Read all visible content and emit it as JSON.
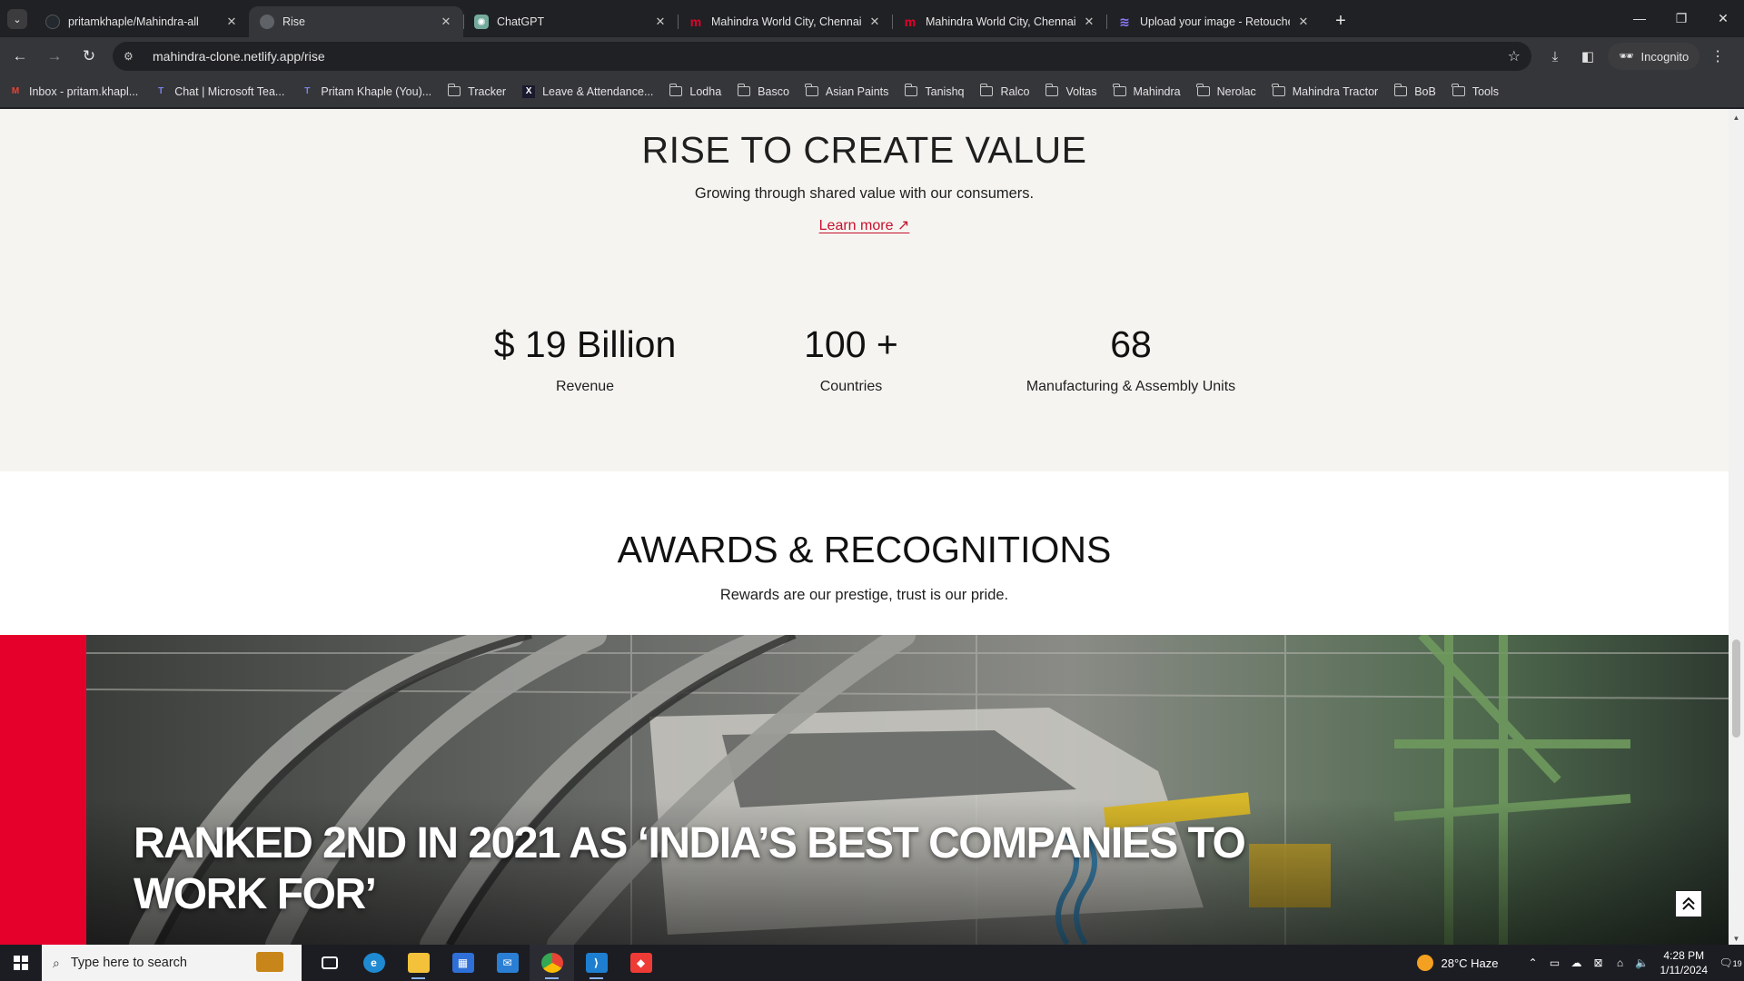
{
  "browser": {
    "tabs": [
      {
        "title": "pritamkhaple/Mahindra-all",
        "favicon": "github-icon",
        "active": false
      },
      {
        "title": "Rise",
        "favicon": "globe-icon",
        "active": true
      },
      {
        "title": "ChatGPT",
        "favicon": "chatgpt-icon",
        "active": false
      },
      {
        "title": "Mahindra World City, Chennai s",
        "favicon": "mahindra-icon",
        "active": false
      },
      {
        "title": "Mahindra World City, Chennai s",
        "favicon": "mahindra-icon",
        "active": false
      },
      {
        "title": "Upload your image - Retoucher",
        "favicon": "retoucher-icon",
        "active": false
      }
    ],
    "url": "mahindra-clone.netlify.app/rise",
    "incognito_label": "Incognito",
    "bookmarks": [
      {
        "label": "Inbox - pritam.khapl...",
        "icon": "gmail-icon"
      },
      {
        "label": "Chat | Microsoft Tea...",
        "icon": "teams-icon"
      },
      {
        "label": "Pritam Khaple (You)...",
        "icon": "teams-icon"
      },
      {
        "label": "Tracker",
        "icon": "folder-icon"
      },
      {
        "label": "Leave & Attendance...",
        "icon": "x-icon"
      },
      {
        "label": "Lodha",
        "icon": "folder-icon"
      },
      {
        "label": "Basco",
        "icon": "folder-icon"
      },
      {
        "label": "Asian Paints",
        "icon": "folder-icon"
      },
      {
        "label": "Tanishq",
        "icon": "folder-icon"
      },
      {
        "label": "Ralco",
        "icon": "folder-icon"
      },
      {
        "label": "Voltas",
        "icon": "folder-icon"
      },
      {
        "label": "Mahindra",
        "icon": "folder-icon"
      },
      {
        "label": "Nerolac",
        "icon": "folder-icon"
      },
      {
        "label": "Mahindra Tractor",
        "icon": "folder-icon"
      },
      {
        "label": "BoB",
        "icon": "folder-icon"
      },
      {
        "label": "Tools",
        "icon": "folder-icon"
      }
    ]
  },
  "page": {
    "value": {
      "title": "RISE TO CREATE VALUE",
      "subtitle": "Growing through shared value with our consumers.",
      "learn_more": "Learn more ↗",
      "stats": [
        {
          "number": "$ 19 Billion",
          "label": "Revenue"
        },
        {
          "number": "100 +",
          "label": "Countries"
        },
        {
          "number": "68",
          "label": "Manufacturing & Assembly Units"
        }
      ]
    },
    "awards": {
      "title": "AWARDS & RECOGNITIONS",
      "subtitle": "Rewards are our prestige, trust is our pride.",
      "headline_line1": "RANKED 2ND IN 2021 AS ‘INDIA’S BEST COMPANIES TO",
      "headline_line2": "WORK FOR’",
      "accent_color": "#e4002b"
    }
  },
  "taskbar": {
    "search_placeholder": "Type here to search",
    "weather": "28°C  Haze",
    "time": "4:28 PM",
    "date": "1/11/2024",
    "notification_count": "19"
  }
}
